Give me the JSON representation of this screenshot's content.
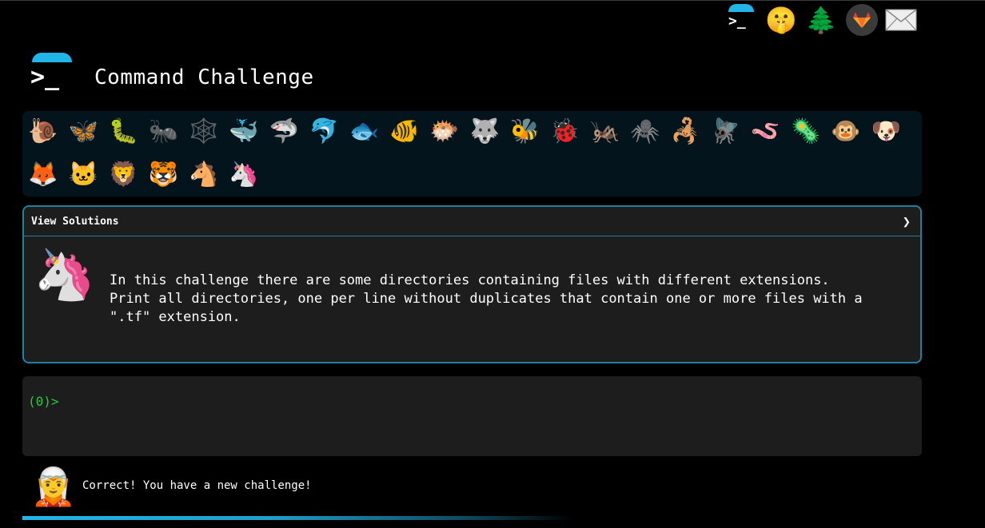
{
  "nav": {
    "items": [
      {
        "name": "terminal",
        "label": ">_"
      },
      {
        "name": "shh",
        "label": "🤫"
      },
      {
        "name": "tree",
        "label": "🌲"
      },
      {
        "name": "gitlab",
        "label": ""
      },
      {
        "name": "mail",
        "label": ""
      }
    ]
  },
  "header": {
    "logo_glyph": ">_",
    "title": "Command Challenge"
  },
  "animals": [
    "🐌",
    "🦋",
    "🐛",
    "🐜",
    "🕸️",
    "🐳",
    "🦈",
    "🐬",
    "🐟",
    "🐠",
    "🐡",
    "🐺",
    "🐝",
    "🐞",
    "🦗",
    "🕷️",
    "🦂",
    "🪰",
    "🪱",
    "🦠",
    "🐵",
    "🐶",
    "🦊",
    "🐱",
    "🦁",
    "🐯",
    "🐴",
    "🦄"
  ],
  "panel": {
    "header_label": "View Solutions",
    "chevron": "❯",
    "avatar": "🦄",
    "description_lines": [
      "In this challenge there are some directories containing files with different extensions.",
      "Print all directories, one per line without duplicates that contain one or more files with a",
      "\".tf\" extension."
    ]
  },
  "terminal": {
    "prompt": "(0)>"
  },
  "status": {
    "avatar": "🧝",
    "message": "Correct! You have a new challenge!"
  },
  "colors": {
    "accent": "#22b5e8",
    "prompt_green": "#25c93e",
    "panel_border": "#22809f",
    "panel_bg": "#1d1d1d",
    "animals_bg": "#03141c"
  },
  "progress": {
    "fraction": 0.57
  }
}
